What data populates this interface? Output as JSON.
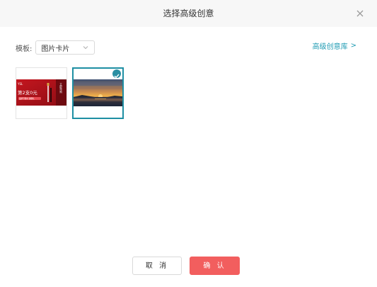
{
  "dialog": {
    "title": "选择高级创意",
    "close_icon": "close-icon"
  },
  "template": {
    "label": "模板:",
    "selected": "图片卡片",
    "chevron_icon": "chevron-down-icon"
  },
  "library_link": {
    "label": "高级创意库",
    "arrow": ">"
  },
  "creatives": [
    {
      "selected": false,
      "thumb_brand": "YSL",
      "thumb_headline": "第2支0元",
      "thumb_sub": "品牌节限时 满赠礼",
      "thumb_cta": "立即抢购"
    },
    {
      "selected": true,
      "check_icon": "check-icon"
    }
  ],
  "footer": {
    "cancel_label": "取 消",
    "confirm_label": "确 认"
  },
  "colors": {
    "accent": "#1f9bb3",
    "selected_border": "#1e8fa3",
    "confirm_button": "#f25e5e",
    "header_bg": "#f7f7f7",
    "promo_red": "#b3121a"
  }
}
